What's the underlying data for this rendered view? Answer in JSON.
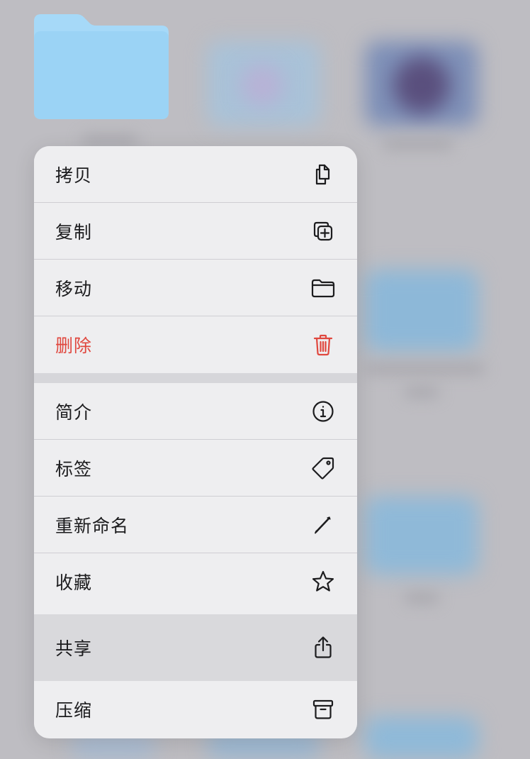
{
  "menu": {
    "items": [
      {
        "label": "拷贝",
        "icon": "copy-icon"
      },
      {
        "label": "复制",
        "icon": "duplicate-icon"
      },
      {
        "label": "移动",
        "icon": "folder-icon"
      },
      {
        "label": "删除",
        "icon": "trash-icon",
        "destructive": true
      },
      {
        "label": "简介",
        "icon": "info-icon"
      },
      {
        "label": "标签",
        "icon": "tag-icon"
      },
      {
        "label": "重新命名",
        "icon": "pencil-icon"
      },
      {
        "label": "收藏",
        "icon": "star-icon"
      },
      {
        "label": "共享",
        "icon": "share-icon",
        "highlighted": true
      },
      {
        "label": "压缩",
        "icon": "archive-icon"
      }
    ]
  },
  "colors": {
    "destructive": "#e0473e",
    "folder": "#9fd5f6",
    "label": "#1c1c1e",
    "menu_background": "#eeeef0"
  }
}
